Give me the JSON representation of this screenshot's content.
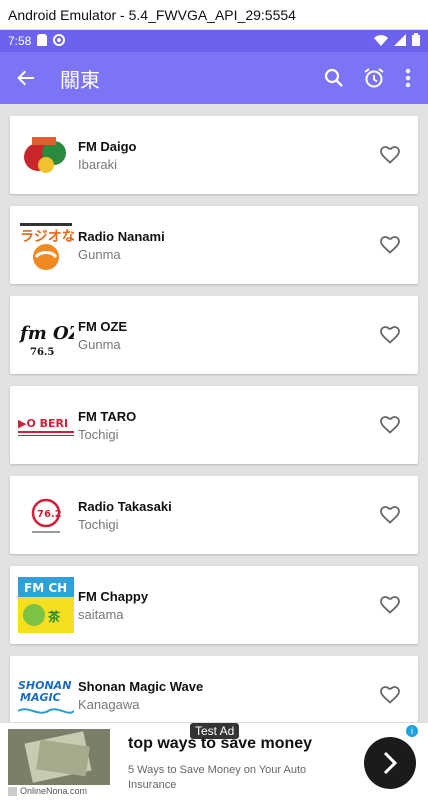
{
  "window": {
    "title": "Android Emulator - 5.4_FWVGA_API_29:5554"
  },
  "status_bar": {
    "time": "7:58"
  },
  "app_bar": {
    "title": "關東",
    "back_icon": "arrow-back-icon",
    "search_icon": "search-icon",
    "alarm_icon": "alarm-icon",
    "more_icon": "more-vert-icon"
  },
  "colors": {
    "primary": "#7b74f5",
    "status": "#6b63f0",
    "list_bg": "#e2e2e2"
  },
  "stations": [
    {
      "name": "FM Daigo",
      "prefecture": "Ibaraki"
    },
    {
      "name": "Radio Nanami",
      "prefecture": "Gunma"
    },
    {
      "name": "FM OZE",
      "prefecture": "Gunma"
    },
    {
      "name": "FM TARO",
      "prefecture": "Tochigi"
    },
    {
      "name": "Radio Takasaki",
      "prefecture": "Tochigi"
    },
    {
      "name": "FM Chappy",
      "prefecture": "saitama"
    },
    {
      "name": "Shonan Magic Wave",
      "prefecture": "Kanagawa"
    }
  ],
  "ad": {
    "badge": "Test Ad",
    "headline": "top ways to save money",
    "subtext": "5 Ways to Save Money on Your Auto Insurance",
    "source": "OnlineNona.com"
  }
}
